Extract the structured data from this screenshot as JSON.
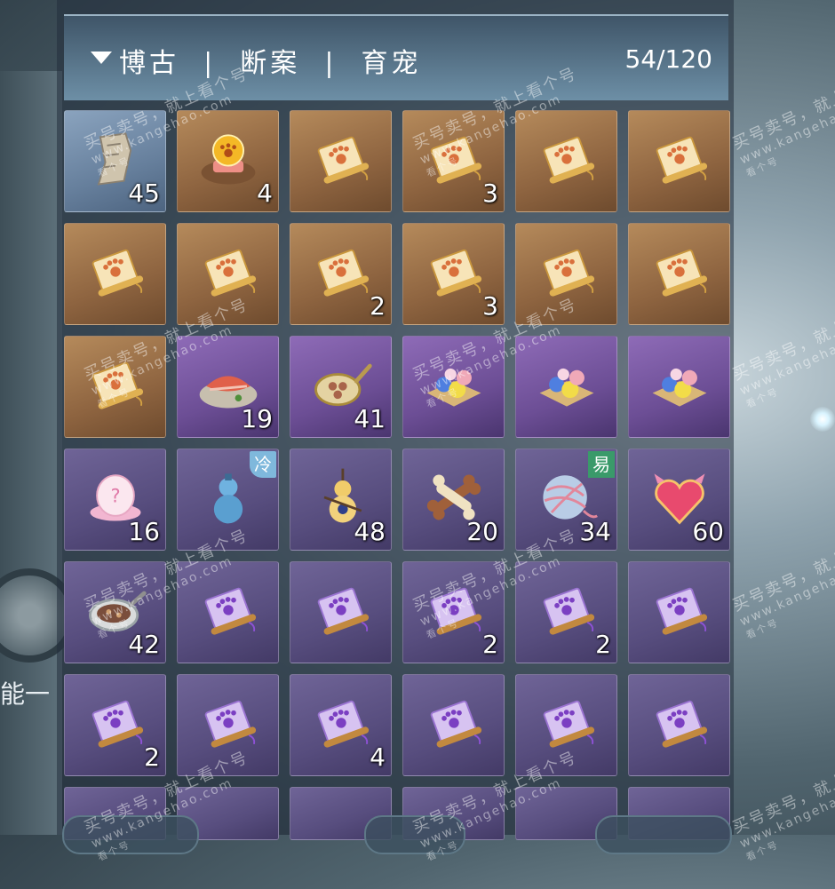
{
  "header": {
    "category_path": "博古  |  断案  |  育宠",
    "capacity": "54/120"
  },
  "side_text": "能一",
  "items": [
    {
      "icon": "scroll-fragment-icon",
      "bg": "blue",
      "qty": "45"
    },
    {
      "icon": "paw-orb-cushion-icon",
      "bg": "gold",
      "qty": "4"
    },
    {
      "icon": "paw-scroll-gold-icon",
      "bg": "gold",
      "qty": ""
    },
    {
      "icon": "paw-scroll-gold-icon",
      "bg": "gold",
      "qty": "3"
    },
    {
      "icon": "paw-scroll-gold-icon",
      "bg": "gold",
      "qty": ""
    },
    {
      "icon": "paw-scroll-gold-icon",
      "bg": "gold",
      "qty": ""
    },
    {
      "icon": "paw-scroll-gold-icon",
      "bg": "gold",
      "qty": ""
    },
    {
      "icon": "paw-scroll-gold-icon",
      "bg": "gold",
      "qty": ""
    },
    {
      "icon": "paw-scroll-gold-icon",
      "bg": "gold",
      "qty": "2"
    },
    {
      "icon": "paw-scroll-gold-icon",
      "bg": "gold",
      "qty": "3"
    },
    {
      "icon": "paw-scroll-gold-icon",
      "bg": "gold",
      "qty": ""
    },
    {
      "icon": "paw-scroll-gold-icon",
      "bg": "gold",
      "qty": ""
    },
    {
      "icon": "paw-scroll-gold-icon",
      "bg": "gold",
      "qty": ""
    },
    {
      "icon": "fish-platter-icon",
      "bg": "purp",
      "qty": "19"
    },
    {
      "icon": "pet-food-pan-icon",
      "bg": "purp",
      "qty": "41"
    },
    {
      "icon": "candy-box-icon",
      "bg": "purp",
      "qty": ""
    },
    {
      "icon": "candy-box-icon",
      "bg": "purp",
      "qty": ""
    },
    {
      "icon": "candy-box-icon",
      "bg": "purp",
      "qty": ""
    },
    {
      "icon": "mystery-egg-icon",
      "bg": "lav",
      "qty": "16"
    },
    {
      "icon": "gourd-bottle-icon",
      "bg": "lav",
      "qty": "",
      "tag": "冷",
      "tag_type": "cold"
    },
    {
      "icon": "gourd-charm-icon",
      "bg": "lav",
      "qty": "48"
    },
    {
      "icon": "bone-toy-icon",
      "bg": "lav",
      "qty": "20"
    },
    {
      "icon": "yarn-ball-icon",
      "bg": "lav",
      "qty": "34",
      "tag": "易",
      "tag_type": "trade"
    },
    {
      "icon": "heart-charm-icon",
      "bg": "lav",
      "qty": "60"
    },
    {
      "icon": "soup-bowl-icon",
      "bg": "lav",
      "qty": "42"
    },
    {
      "icon": "paw-scroll-purple-icon",
      "bg": "lav",
      "qty": ""
    },
    {
      "icon": "paw-scroll-purple-icon",
      "bg": "lav",
      "qty": ""
    },
    {
      "icon": "paw-scroll-purple-icon",
      "bg": "lav",
      "qty": "2"
    },
    {
      "icon": "paw-scroll-purple-icon",
      "bg": "lav",
      "qty": "2"
    },
    {
      "icon": "paw-scroll-purple-icon",
      "bg": "lav",
      "qty": ""
    },
    {
      "icon": "paw-scroll-purple-icon",
      "bg": "lav",
      "qty": "2"
    },
    {
      "icon": "paw-scroll-purple-icon",
      "bg": "lav",
      "qty": ""
    },
    {
      "icon": "paw-scroll-purple-icon",
      "bg": "lav",
      "qty": "4"
    },
    {
      "icon": "paw-scroll-purple-icon",
      "bg": "lav",
      "qty": ""
    },
    {
      "icon": "paw-scroll-purple-icon",
      "bg": "lav",
      "qty": ""
    },
    {
      "icon": "paw-scroll-purple-icon",
      "bg": "lav",
      "qty": ""
    },
    {
      "icon": "",
      "bg": "lav",
      "qty": "",
      "cut": true
    },
    {
      "icon": "",
      "bg": "lav",
      "qty": "",
      "cut": true
    },
    {
      "icon": "",
      "bg": "lav",
      "qty": "",
      "cut": true
    },
    {
      "icon": "",
      "bg": "lav",
      "qty": "",
      "cut": true
    },
    {
      "icon": "",
      "bg": "lav",
      "qty": "",
      "cut": true
    },
    {
      "icon": "",
      "bg": "lav",
      "qty": "",
      "cut": true
    }
  ],
  "watermark": {
    "line1": "买号卖号，就上看个号",
    "line2": "www.kangehao.com",
    "line3": "看个号"
  }
}
